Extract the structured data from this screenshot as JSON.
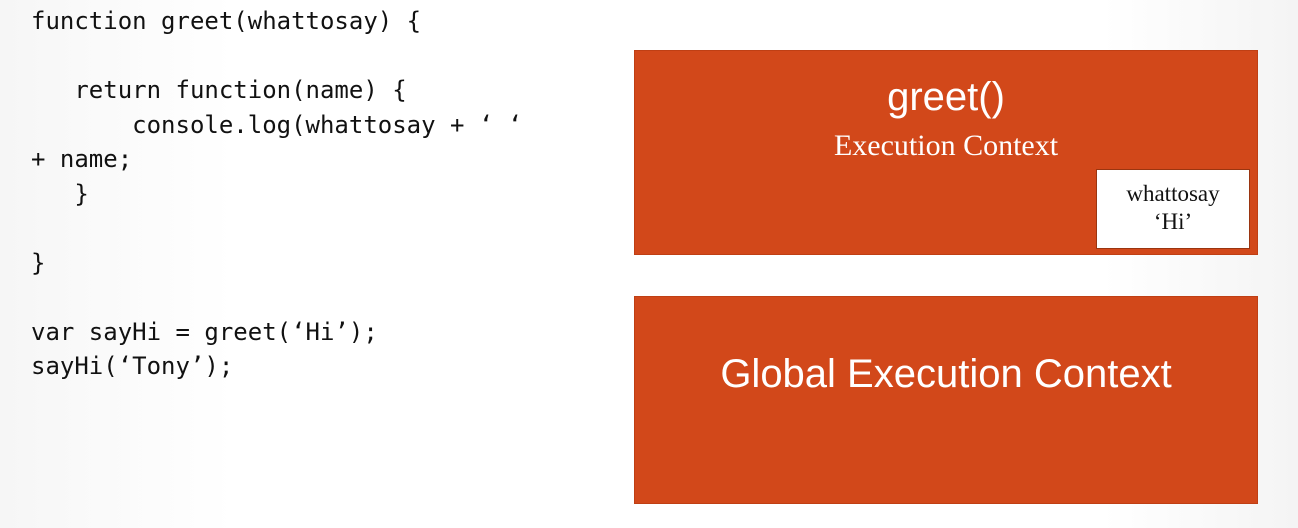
{
  "code": {
    "lines": [
      "function greet(whattosay) {",
      "",
      "   return function(name) {",
      "       console.log(whattosay + ‘ ‘",
      "+ name;",
      "   }",
      "",
      "}",
      "",
      "var sayHi = greet(‘Hi’);",
      "sayHi(‘Tony’);"
    ]
  },
  "greet_context": {
    "title": "greet()",
    "subtitle": "Execution Context",
    "variable": {
      "name": "whattosay",
      "value": "‘Hi’"
    }
  },
  "global_context": {
    "title": "Global Execution Context"
  },
  "colors": {
    "context_fill": "#d2481a",
    "text_on_context": "#ffffff",
    "code_text": "#111111"
  }
}
